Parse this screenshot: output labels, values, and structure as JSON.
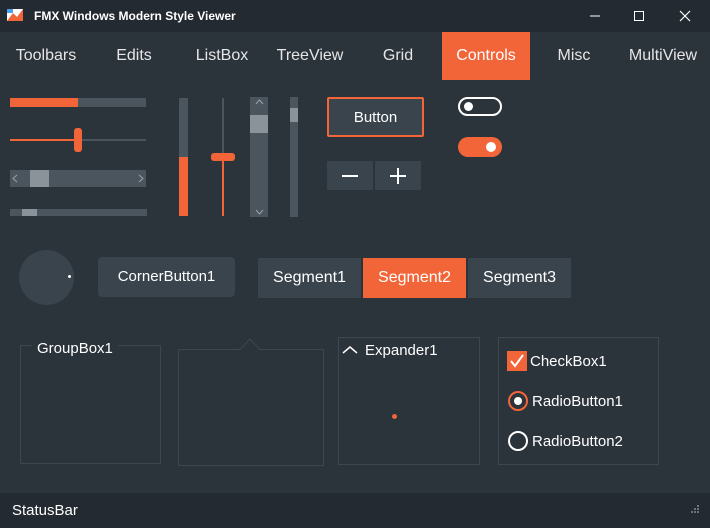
{
  "window": {
    "title": "FMX Windows Modern Style Viewer",
    "icons": [
      "app-icon",
      "minimize-icon",
      "maximize-icon",
      "close-icon"
    ]
  },
  "tabs": [
    {
      "label": "Toolbars",
      "active": false
    },
    {
      "label": "Edits",
      "active": false
    },
    {
      "label": "ListBox",
      "active": false
    },
    {
      "label": "TreeView",
      "active": false
    },
    {
      "label": "Grid",
      "active": false
    },
    {
      "label": "Controls",
      "active": true
    },
    {
      "label": "Misc",
      "active": false
    },
    {
      "label": "MultiView",
      "active": false
    }
  ],
  "colors": {
    "accent": "#f26539",
    "background": "#2b333b",
    "titlebar": "#232a31",
    "control": "#3a444d",
    "track": "#4a555e"
  },
  "controls": {
    "progress_horizontal": 0.5,
    "trackbar_horizontal": 0.5,
    "scrollbar_horizontal": 0.1,
    "scroll_small_horizontal": 0.1,
    "progress_vertical": 0.5,
    "trackbar_vertical": 0.5,
    "scrollbar_vertical": 0.1,
    "button_label": "Button",
    "spin_minus_icon": "minus-icon",
    "spin_plus_icon": "plus-icon",
    "switch_off": false,
    "switch_on": true,
    "corner_button_label": "CornerButton1",
    "segments": [
      {
        "label": "Segment1",
        "active": false
      },
      {
        "label": "Segment2",
        "active": true
      },
      {
        "label": "Segment3",
        "active": false
      }
    ],
    "groupbox_label": "GroupBox1",
    "expander_label": "Expander1",
    "checkbox_label": "CheckBox1",
    "checkbox_checked": true,
    "radio1_label": "RadioButton1",
    "radio1_checked": true,
    "radio2_label": "RadioButton2",
    "radio2_checked": false
  },
  "statusbar": {
    "text": "StatusBar"
  }
}
